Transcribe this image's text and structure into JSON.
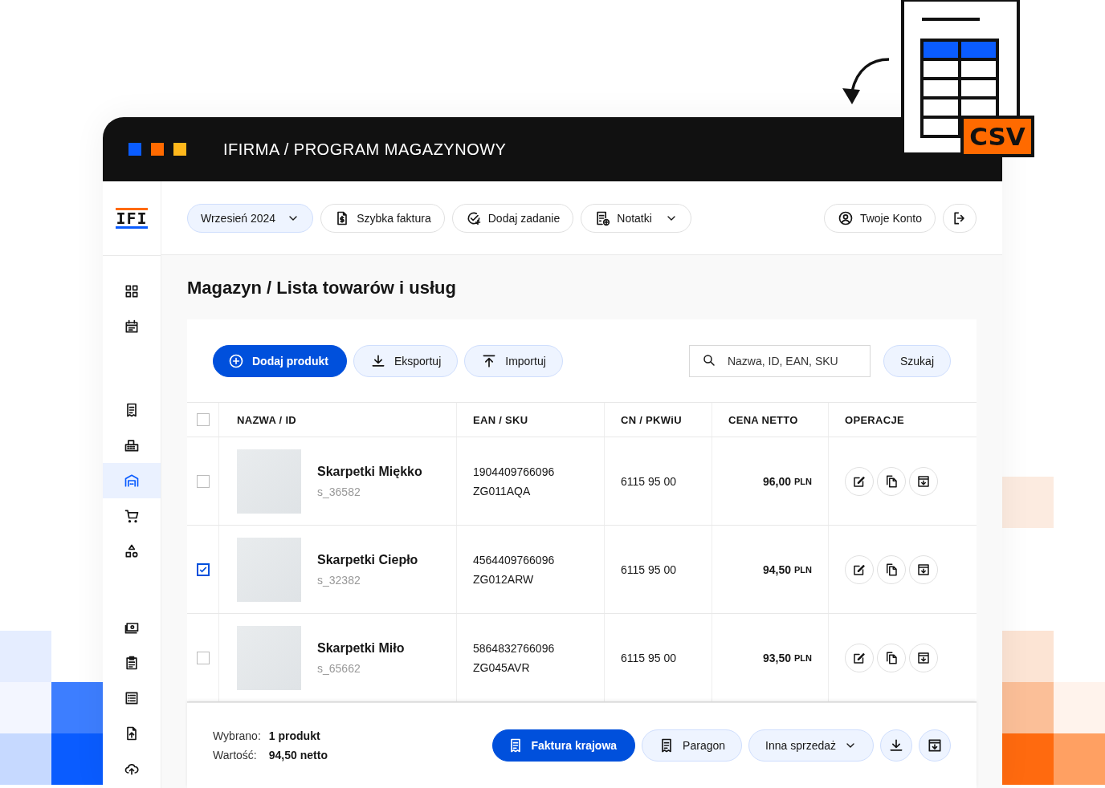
{
  "window": {
    "title": "IFIRMA / PROGRAM MAGAZYNOWY",
    "dots": [
      {
        "color": "#0a5cff"
      },
      {
        "color": "#ff6a00"
      },
      {
        "color": "#ffb81c"
      }
    ]
  },
  "csv_badge": {
    "label": "CSV"
  },
  "sidebar": {
    "logo": "IFI",
    "groups": [
      [
        {
          "selected": false
        },
        {
          "selected": false
        }
      ],
      [
        {
          "selected": false
        },
        {
          "selected": false
        },
        {
          "selected": true
        },
        {
          "selected": false
        },
        {
          "selected": false
        }
      ],
      [
        {
          "selected": false
        },
        {
          "selected": false
        },
        {
          "selected": false
        },
        {
          "selected": false
        },
        {
          "selected": false
        }
      ]
    ]
  },
  "topbar": {
    "items": [
      {
        "kind": "period",
        "label": "Wrzesień 2024",
        "dropdown": true
      },
      {
        "kind": "action",
        "label": "Szybka faktura",
        "dropdown": false
      },
      {
        "kind": "action",
        "label": "Dodaj zadanie",
        "dropdown": false
      },
      {
        "kind": "action",
        "label": "Notatki",
        "dropdown": true
      }
    ],
    "account": {
      "label": "Twoje Konto"
    }
  },
  "page_title": "Magazyn / Lista towarów i usług",
  "actions": [
    {
      "kind": "primary",
      "label": "Dodaj produkt"
    },
    {
      "kind": "secondary",
      "label": "Eksportuj"
    },
    {
      "kind": "secondary",
      "label": "Importuj"
    }
  ],
  "search": {
    "placeholder": "Nazwa, ID, EAN, SKU",
    "button": "Szukaj"
  },
  "table": {
    "all_checked": false,
    "columns": [
      "NAZWA / ID",
      "EAN / SKU",
      "CN / PKWiU",
      "CENA NETTO",
      "OPERACJE"
    ],
    "rows": [
      {
        "selected": false,
        "name": "Skarpetki Miękko",
        "id": "s_36582",
        "ean": "1904409766096",
        "sku": "ZG011AQA",
        "cn": "6115 95 00",
        "price": "96,00",
        "currency": "PLN"
      },
      {
        "selected": true,
        "name": "Skarpetki Ciepło",
        "id": "s_32382",
        "ean": "4564409766096",
        "sku": "ZG012ARW",
        "cn": "6115 95 00",
        "price": "94,50",
        "currency": "PLN"
      },
      {
        "selected": false,
        "name": "Skarpetki Miło",
        "id": "s_65662",
        "ean": "5864832766096",
        "sku": "ZG045AVR",
        "cn": "6115 95 00",
        "price": "93,50",
        "currency": "PLN"
      }
    ]
  },
  "footer": {
    "summary": [
      {
        "label": "Wybrano:",
        "value": "1 produkt"
      },
      {
        "label": "Wartość:",
        "value": "94,50 netto"
      }
    ],
    "buttons": [
      {
        "kind": "primary",
        "label": "Faktura krajowa"
      },
      {
        "kind": "secondary",
        "label": "Paragon"
      },
      {
        "kind": "dropdown",
        "label": "Inna sprzedaż"
      },
      {
        "kind": "icon"
      },
      {
        "kind": "icon"
      }
    ]
  }
}
